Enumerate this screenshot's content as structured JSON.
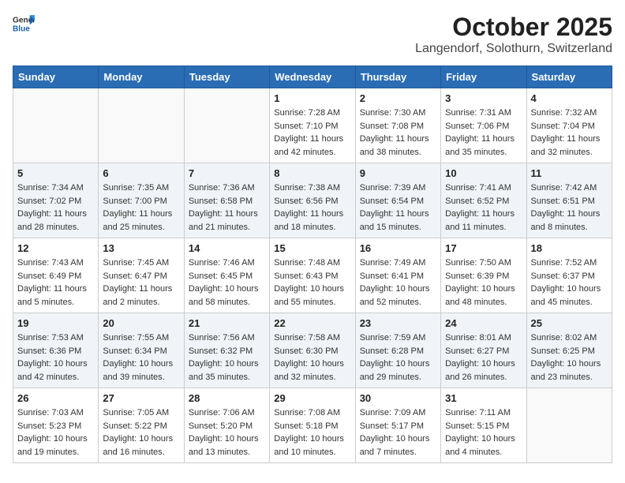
{
  "header": {
    "logo_general": "General",
    "logo_blue": "Blue",
    "month": "October 2025",
    "location": "Langendorf, Solothurn, Switzerland"
  },
  "weekdays": [
    "Sunday",
    "Monday",
    "Tuesday",
    "Wednesday",
    "Thursday",
    "Friday",
    "Saturday"
  ],
  "weeks": [
    [
      {
        "day": "",
        "sunrise": "",
        "sunset": "",
        "daylight": ""
      },
      {
        "day": "",
        "sunrise": "",
        "sunset": "",
        "daylight": ""
      },
      {
        "day": "",
        "sunrise": "",
        "sunset": "",
        "daylight": ""
      },
      {
        "day": "1",
        "sunrise": "Sunrise: 7:28 AM",
        "sunset": "Sunset: 7:10 PM",
        "daylight": "Daylight: 11 hours and 42 minutes."
      },
      {
        "day": "2",
        "sunrise": "Sunrise: 7:30 AM",
        "sunset": "Sunset: 7:08 PM",
        "daylight": "Daylight: 11 hours and 38 minutes."
      },
      {
        "day": "3",
        "sunrise": "Sunrise: 7:31 AM",
        "sunset": "Sunset: 7:06 PM",
        "daylight": "Daylight: 11 hours and 35 minutes."
      },
      {
        "day": "4",
        "sunrise": "Sunrise: 7:32 AM",
        "sunset": "Sunset: 7:04 PM",
        "daylight": "Daylight: 11 hours and 32 minutes."
      }
    ],
    [
      {
        "day": "5",
        "sunrise": "Sunrise: 7:34 AM",
        "sunset": "Sunset: 7:02 PM",
        "daylight": "Daylight: 11 hours and 28 minutes."
      },
      {
        "day": "6",
        "sunrise": "Sunrise: 7:35 AM",
        "sunset": "Sunset: 7:00 PM",
        "daylight": "Daylight: 11 hours and 25 minutes."
      },
      {
        "day": "7",
        "sunrise": "Sunrise: 7:36 AM",
        "sunset": "Sunset: 6:58 PM",
        "daylight": "Daylight: 11 hours and 21 minutes."
      },
      {
        "day": "8",
        "sunrise": "Sunrise: 7:38 AM",
        "sunset": "Sunset: 6:56 PM",
        "daylight": "Daylight: 11 hours and 18 minutes."
      },
      {
        "day": "9",
        "sunrise": "Sunrise: 7:39 AM",
        "sunset": "Sunset: 6:54 PM",
        "daylight": "Daylight: 11 hours and 15 minutes."
      },
      {
        "day": "10",
        "sunrise": "Sunrise: 7:41 AM",
        "sunset": "Sunset: 6:52 PM",
        "daylight": "Daylight: 11 hours and 11 minutes."
      },
      {
        "day": "11",
        "sunrise": "Sunrise: 7:42 AM",
        "sunset": "Sunset: 6:51 PM",
        "daylight": "Daylight: 11 hours and 8 minutes."
      }
    ],
    [
      {
        "day": "12",
        "sunrise": "Sunrise: 7:43 AM",
        "sunset": "Sunset: 6:49 PM",
        "daylight": "Daylight: 11 hours and 5 minutes."
      },
      {
        "day": "13",
        "sunrise": "Sunrise: 7:45 AM",
        "sunset": "Sunset: 6:47 PM",
        "daylight": "Daylight: 11 hours and 2 minutes."
      },
      {
        "day": "14",
        "sunrise": "Sunrise: 7:46 AM",
        "sunset": "Sunset: 6:45 PM",
        "daylight": "Daylight: 10 hours and 58 minutes."
      },
      {
        "day": "15",
        "sunrise": "Sunrise: 7:48 AM",
        "sunset": "Sunset: 6:43 PM",
        "daylight": "Daylight: 10 hours and 55 minutes."
      },
      {
        "day": "16",
        "sunrise": "Sunrise: 7:49 AM",
        "sunset": "Sunset: 6:41 PM",
        "daylight": "Daylight: 10 hours and 52 minutes."
      },
      {
        "day": "17",
        "sunrise": "Sunrise: 7:50 AM",
        "sunset": "Sunset: 6:39 PM",
        "daylight": "Daylight: 10 hours and 48 minutes."
      },
      {
        "day": "18",
        "sunrise": "Sunrise: 7:52 AM",
        "sunset": "Sunset: 6:37 PM",
        "daylight": "Daylight: 10 hours and 45 minutes."
      }
    ],
    [
      {
        "day": "19",
        "sunrise": "Sunrise: 7:53 AM",
        "sunset": "Sunset: 6:36 PM",
        "daylight": "Daylight: 10 hours and 42 minutes."
      },
      {
        "day": "20",
        "sunrise": "Sunrise: 7:55 AM",
        "sunset": "Sunset: 6:34 PM",
        "daylight": "Daylight: 10 hours and 39 minutes."
      },
      {
        "day": "21",
        "sunrise": "Sunrise: 7:56 AM",
        "sunset": "Sunset: 6:32 PM",
        "daylight": "Daylight: 10 hours and 35 minutes."
      },
      {
        "day": "22",
        "sunrise": "Sunrise: 7:58 AM",
        "sunset": "Sunset: 6:30 PM",
        "daylight": "Daylight: 10 hours and 32 minutes."
      },
      {
        "day": "23",
        "sunrise": "Sunrise: 7:59 AM",
        "sunset": "Sunset: 6:28 PM",
        "daylight": "Daylight: 10 hours and 29 minutes."
      },
      {
        "day": "24",
        "sunrise": "Sunrise: 8:01 AM",
        "sunset": "Sunset: 6:27 PM",
        "daylight": "Daylight: 10 hours and 26 minutes."
      },
      {
        "day": "25",
        "sunrise": "Sunrise: 8:02 AM",
        "sunset": "Sunset: 6:25 PM",
        "daylight": "Daylight: 10 hours and 23 minutes."
      }
    ],
    [
      {
        "day": "26",
        "sunrise": "Sunrise: 7:03 AM",
        "sunset": "Sunset: 5:23 PM",
        "daylight": "Daylight: 10 hours and 19 minutes."
      },
      {
        "day": "27",
        "sunrise": "Sunrise: 7:05 AM",
        "sunset": "Sunset: 5:22 PM",
        "daylight": "Daylight: 10 hours and 16 minutes."
      },
      {
        "day": "28",
        "sunrise": "Sunrise: 7:06 AM",
        "sunset": "Sunset: 5:20 PM",
        "daylight": "Daylight: 10 hours and 13 minutes."
      },
      {
        "day": "29",
        "sunrise": "Sunrise: 7:08 AM",
        "sunset": "Sunset: 5:18 PM",
        "daylight": "Daylight: 10 hours and 10 minutes."
      },
      {
        "day": "30",
        "sunrise": "Sunrise: 7:09 AM",
        "sunset": "Sunset: 5:17 PM",
        "daylight": "Daylight: 10 hours and 7 minutes."
      },
      {
        "day": "31",
        "sunrise": "Sunrise: 7:11 AM",
        "sunset": "Sunset: 5:15 PM",
        "daylight": "Daylight: 10 hours and 4 minutes."
      },
      {
        "day": "",
        "sunrise": "",
        "sunset": "",
        "daylight": ""
      }
    ]
  ]
}
